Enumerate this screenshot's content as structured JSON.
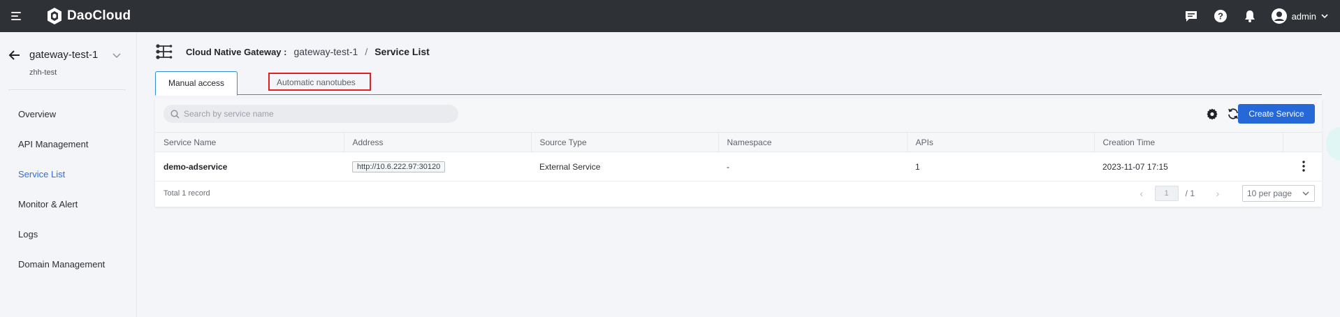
{
  "app": {
    "brand": "DaoCloud",
    "user": "admin"
  },
  "sidebar": {
    "title": "gateway-test-1",
    "subtitle": "zhh-test",
    "items": [
      {
        "label": "Overview"
      },
      {
        "label": "API Management"
      },
      {
        "label": "Service List"
      },
      {
        "label": "Monitor & Alert"
      },
      {
        "label": "Logs"
      },
      {
        "label": "Domain Management"
      }
    ],
    "active_index": 2
  },
  "breadcrumb": {
    "gateway_label": "Cloud Native Gateway :",
    "gateway_name": "gateway-test-1",
    "separator": "/",
    "page": "Service List"
  },
  "tabs": [
    {
      "label": "Manual access"
    },
    {
      "label": "Automatic nanotubes"
    }
  ],
  "toolbar": {
    "search_placeholder": "Search by service name",
    "create_label": "Create Service"
  },
  "table": {
    "columns": [
      "Service Name",
      "Address",
      "Source Type",
      "Namespace",
      "APIs",
      "Creation Time"
    ],
    "rows": [
      {
        "name": "demo-adservice",
        "address": "http://10.6.222.97:30120",
        "source_type": "External Service",
        "namespace": "-",
        "apis": "1",
        "created": "2023-11-07 17:15"
      }
    ]
  },
  "pagination": {
    "total_text": "Total 1 record",
    "current_page": "1",
    "total_pages": "/ 1",
    "page_size": "10 per page"
  },
  "colors": {
    "topbar": "#2e3135",
    "primary": "#2668d8",
    "active_nav": "#2f6ed8",
    "highlight": "#e02020"
  }
}
